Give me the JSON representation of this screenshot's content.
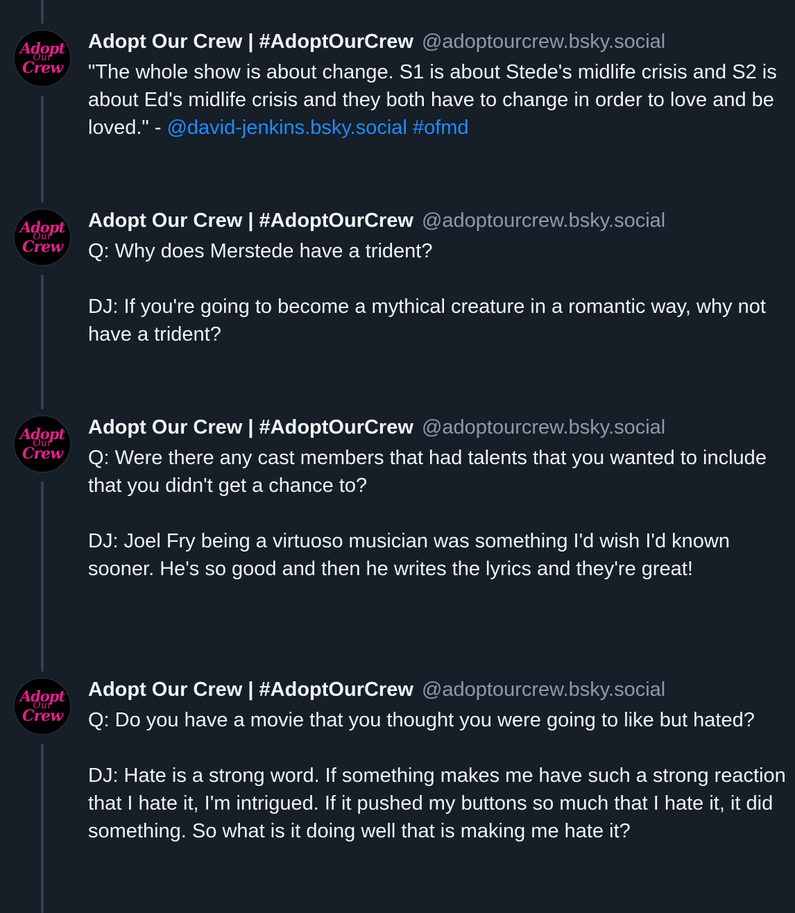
{
  "author": {
    "display_name": "Adopt Our Crew | #AdoptOurCrew",
    "handle": "@adoptourcrew.bsky.social",
    "avatar_text": {
      "line1": "Adopt",
      "line2": "Our",
      "line3": "Crew"
    }
  },
  "colors": {
    "background": "#161e27",
    "thread_line": "#2e4052",
    "handle": "#8d9aa9",
    "link": "#208bfe",
    "avatar_text": "#e0218a"
  },
  "posts": [
    {
      "quote": "\"The whole show is about change. S1 is about Stede's midlife crisis and S2 is about Ed's midlife crisis and they both have to change in order to love and be loved.\" - ",
      "mention": "@david-jenkins.bsky.social",
      "hashtag": "#ofmd"
    },
    {
      "question": "Q: Why does Merstede have a trident?",
      "answer": "DJ: If you're going to become a mythical creature in a romantic way, why not have a trident?"
    },
    {
      "question": "Q: Were there any cast members that had talents that you wanted to include that you didn't get a chance to?",
      "answer": "DJ: Joel Fry being a virtuoso musician was something I'd wish I'd known sooner. He's so good and then he writes the lyrics and they're great!"
    },
    {
      "question": "Q: Do you have a movie that you thought you were going to like but hated?",
      "answer": "DJ: Hate is a strong word. If something makes me have such a strong reaction that I hate it, I'm intrigued. If it pushed my buttons so much that I hate it, it did something. So what is it doing well that is making me hate it?"
    }
  ]
}
